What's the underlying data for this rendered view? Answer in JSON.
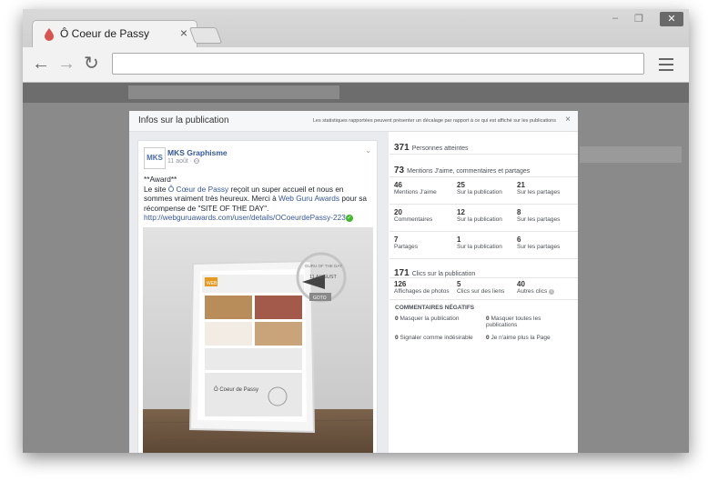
{
  "browser": {
    "tab_title": "Ô Coeur de Passy",
    "tab_close": "×",
    "minimize": "–",
    "restore": "❐",
    "close": "✕",
    "back": "←",
    "forward": "→",
    "reload": "↻",
    "address": ""
  },
  "modal": {
    "title": "Infos sur la publication",
    "note": "Les statistiques rapportées peuvent présenter un décalage par rapport à ce qui est affiché sur les publications",
    "close": "×"
  },
  "post": {
    "avatar_text": "MKS",
    "page_name": "MKS Graphisme",
    "date": "11 août · ",
    "award_line": "**Award**",
    "text_1": "Le site ",
    "link_1": "Ô Cœur de Passy",
    "text_2": " reçoit un super accueil et nous en sommes vraiment très heureux. Merci à ",
    "link_2": "Web Guru Awards",
    "text_3": " pour sa récompense de \"SITE OF THE DAY\".",
    "url": "http://webguruawards.com/user/details/OCoeurdePassy-223",
    "image": {
      "badge_line1": "GURU OF THE DAY",
      "badge_date": "11 AUGUST",
      "goto": "GOTO",
      "site_name": "Ô Coeur de Passy",
      "logo_text": "WEB"
    }
  },
  "stats": {
    "reach": {
      "value": "371",
      "label": "Personnes atteintes"
    },
    "engagement": {
      "value": "73",
      "label": "Mentions J'aime, commentaires et partages"
    },
    "likes_row": [
      {
        "value": "46",
        "label": "Mentions J'aime"
      },
      {
        "value": "25",
        "label": "Sur la publication"
      },
      {
        "value": "21",
        "label": "Sur les partages"
      }
    ],
    "comments_row": [
      {
        "value": "20",
        "label": "Commentaires"
      },
      {
        "value": "12",
        "label": "Sur la publication"
      },
      {
        "value": "8",
        "label": "Sur les partages"
      }
    ],
    "shares_row": [
      {
        "value": "7",
        "label": "Partages"
      },
      {
        "value": "1",
        "label": "Sur la publication"
      },
      {
        "value": "6",
        "label": "Sur les partages"
      }
    ],
    "clicks": {
      "value": "171",
      "label": "Clics sur la publication"
    },
    "clicks_row": [
      {
        "value": "126",
        "label": "Affichages de photos"
      },
      {
        "value": "5",
        "label": "Clics sur des liens"
      },
      {
        "value": "40",
        "label": "Autres clics"
      }
    ],
    "negative": {
      "title": "COMMENTAIRES NÉGATIFS",
      "items": [
        {
          "value": "0",
          "label": "Masquer la publication"
        },
        {
          "value": "0",
          "label": "Masquer toutes les publications"
        },
        {
          "value": "0",
          "label": "Signaler comme indésirable"
        },
        {
          "value": "0",
          "label": "Je n'aime plus la Page"
        }
      ]
    }
  }
}
